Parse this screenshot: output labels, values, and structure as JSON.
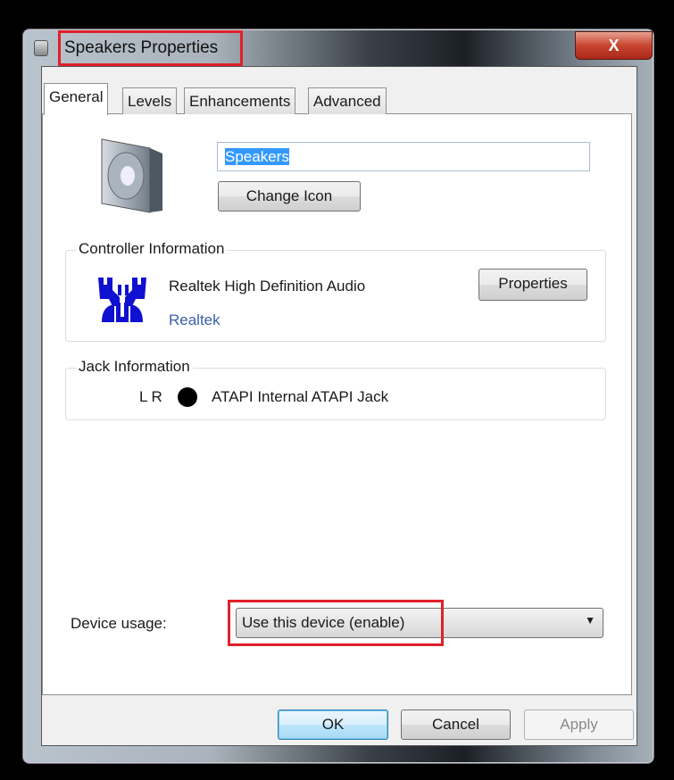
{
  "window": {
    "title": "Speakers Properties",
    "close_label": "X"
  },
  "tabs": [
    {
      "label": "General",
      "active": true
    },
    {
      "label": "Levels"
    },
    {
      "label": "Enhancements"
    },
    {
      "label": "Advanced"
    }
  ],
  "general": {
    "device_name": "Speakers",
    "change_icon_label": "Change Icon",
    "controller": {
      "title": "Controller Information",
      "name": "Realtek High Definition Audio",
      "vendor_link": "Realtek",
      "properties_label": "Properties"
    },
    "jack": {
      "title": "Jack Information",
      "channels": "L R",
      "jack_color": "#000000",
      "description": "ATAPI Internal ATAPI Jack"
    },
    "device_usage": {
      "label": "Device usage:",
      "value": "Use this device (enable)"
    }
  },
  "footer": {
    "ok": "OK",
    "cancel": "Cancel",
    "apply": "Apply"
  },
  "colors": {
    "highlight": "#e0202a",
    "link": "#3a5faa",
    "realtek_logo": "#1010d0"
  }
}
